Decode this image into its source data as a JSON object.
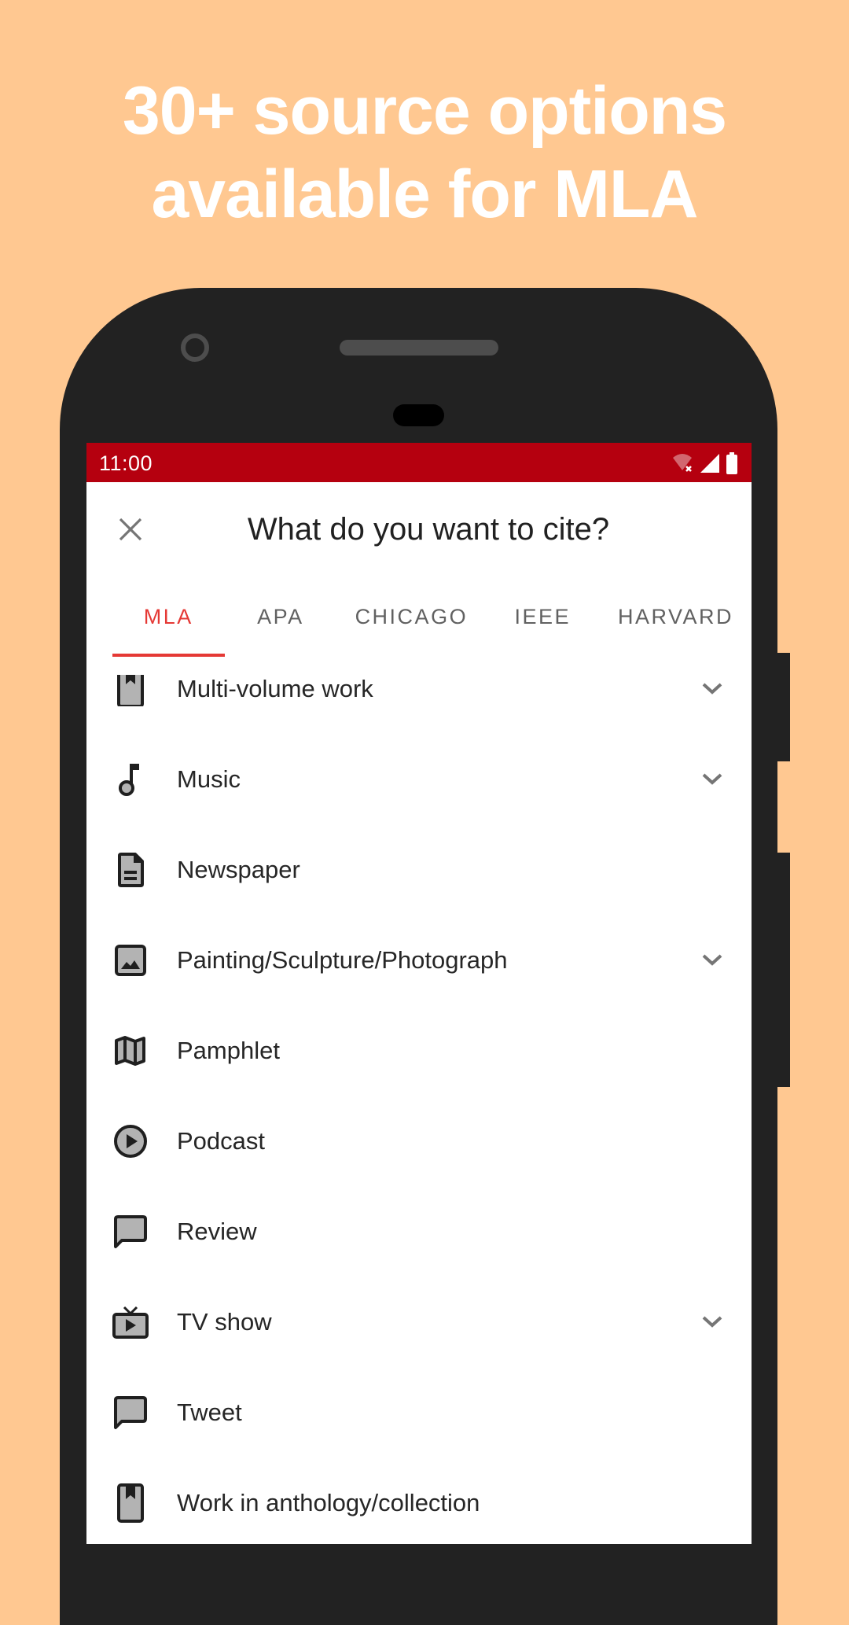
{
  "headline": {
    "line1": "30+ source options",
    "line2": "available for MLA"
  },
  "colors": {
    "background": "#FFC891",
    "status_bar": "#B5000F",
    "accent": "#E53935",
    "phone_body": "#222222"
  },
  "status_bar": {
    "time": "11:00",
    "icons": [
      "wifi-off-icon",
      "cell-signal-icon",
      "battery-icon"
    ]
  },
  "app_bar": {
    "close_icon": "close-icon",
    "title": "What do you want to cite?"
  },
  "tabs": [
    {
      "label": "MLA",
      "active": true
    },
    {
      "label": "APA",
      "active": false
    },
    {
      "label": "CHICAGO",
      "active": false
    },
    {
      "label": "IEEE",
      "active": false
    },
    {
      "label": "HARVARD",
      "active": false
    }
  ],
  "source_list": [
    {
      "label": "Multi-volume work",
      "icon": "book-bookmark-icon",
      "expandable": true
    },
    {
      "label": "Music",
      "icon": "music-note-icon",
      "expandable": true
    },
    {
      "label": "Newspaper",
      "icon": "document-icon",
      "expandable": false
    },
    {
      "label": "Painting/Sculpture/Photograph",
      "icon": "image-icon",
      "expandable": true
    },
    {
      "label": "Pamphlet",
      "icon": "map-icon",
      "expandable": false
    },
    {
      "label": "Podcast",
      "icon": "play-circle-icon",
      "expandable": false
    },
    {
      "label": "Review",
      "icon": "comment-icon",
      "expandable": false
    },
    {
      "label": "TV show",
      "icon": "tv-icon",
      "expandable": true
    },
    {
      "label": "Tweet",
      "icon": "comment-icon",
      "expandable": false
    },
    {
      "label": "Work in anthology/collection",
      "icon": "book-bookmark-icon",
      "expandable": false
    }
  ]
}
